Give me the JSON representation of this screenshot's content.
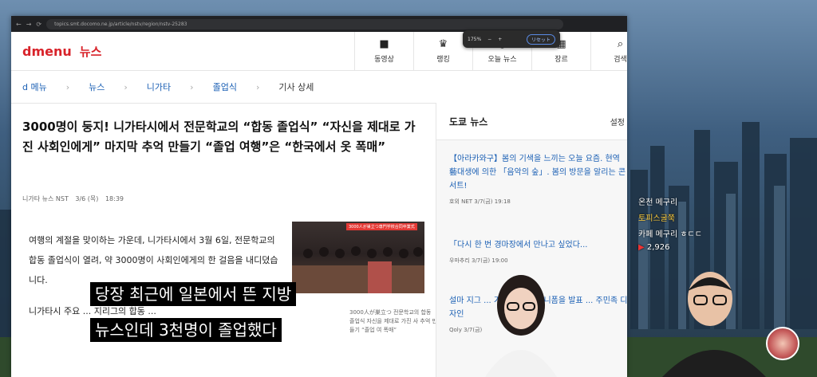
{
  "browser": {
    "url": "topics.smt.docomo.ne.jp/article/nstv/region/nstv-25283",
    "zoom_label": "175%",
    "zoom_minus": "−",
    "zoom_plus": "+",
    "zoom_reset": "リセット"
  },
  "site": {
    "logo": "dmenu",
    "section": "뉴스",
    "nav": [
      {
        "label": "동영상",
        "icon": "video-icon"
      },
      {
        "label": "랭킹",
        "icon": "trophy-icon"
      },
      {
        "label": "오늘 뉴스",
        "icon": "clock-icon"
      },
      {
        "label": "장르",
        "icon": "grid-icon"
      },
      {
        "label": "검색",
        "icon": "search-icon"
      }
    ]
  },
  "breadcrumb": [
    "d 메뉴",
    "뉴스",
    "니가타",
    "졸업식",
    "기사 상세"
  ],
  "article": {
    "title": "3000명이 둥지! 니가타시에서 전문학교의 “합동 졸업식” “자신을 제대로 가진 사회인에게” 마지막 추억 만들기 “졸업 여행”은 “한국에서 옷 폭매”",
    "source": "니가타 뉴스 NST",
    "date": "3/6 (목)",
    "time": "18:39",
    "body1": "여행의 계절을 맞이하는 가운데, 니가타시에서 3월 6일, 전문학교의 합동 졸업식이 열려, 약 3000명이 사회인에게의 한 걸음을 내디뎠습니다.",
    "body2": "니가타시 주요 ... 지리그의 합동 ...",
    "photo_tag": "3000人が巣立つ専門学校合同卒業式",
    "caption": "3000人が巣立つ 전문학교의 합동 졸업식 자신을 제대로 가진 사 추억 만들기 “졸업 여 폭매”"
  },
  "sidebar": {
    "heading": "도쿄 뉴스",
    "settings": "설정",
    "items": [
      {
        "title": "【아라카와구】봄의 기색을 느끼는 오늘 요즘. 현역 藝대생에 의한 「음악의 숲」. 봄의 방문을 알리는 콘서트!",
        "source": "호외 NET",
        "date": "3/7(금)",
        "time": "19:18"
      },
      {
        "title": "「다시 한 번 경마장에서 만나고 싶었다...",
        "source": "우마추리",
        "date": "3/7(금)",
        "time": "19:00"
      },
      {
        "title": "설마 지그 ... 가 2025 신 유니폼을 발표 ... 주민족 디자인",
        "source": "Qoly",
        "date": "3/7(금)",
        "time": ""
      }
    ]
  },
  "overlay": {
    "line1": "온천 메구리",
    "line2": "토피스굴쭉",
    "line3": "카페 메구리 ㅎㄷㄷ",
    "views": "2,926"
  },
  "subtitles": {
    "line1": "당장 최근에 일본에서 뜬 지방",
    "line2": "뉴스인데 3천명이 졸업했다"
  },
  "colors": {
    "brand": "#d8232a",
    "link": "#1a5fb4"
  }
}
